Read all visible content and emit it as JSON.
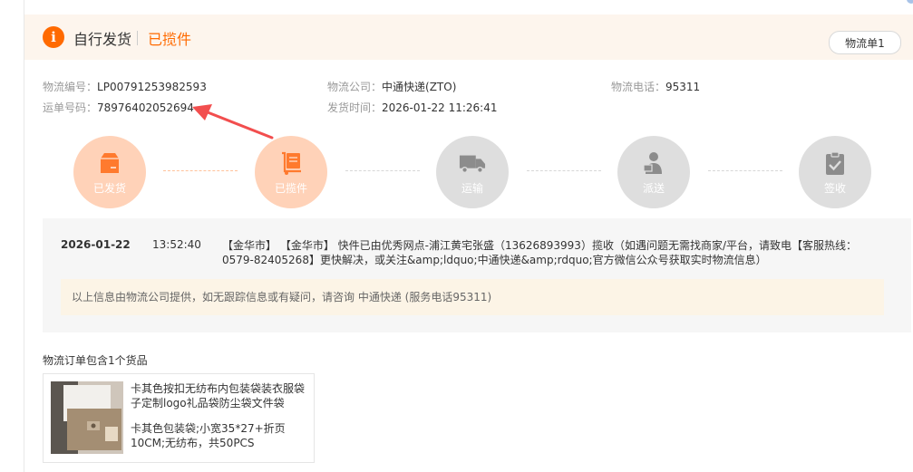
{
  "header": {
    "title": "自行发货",
    "status": "已揽件",
    "tab_label": "物流单1",
    "icon": "info-icon",
    "accent_color": "#ff6a00"
  },
  "meta": {
    "tracking_id_label": "物流编号：",
    "tracking_id": "LP00791253982593",
    "waybill_label": "运单号码：",
    "waybill": "78976402052694",
    "company_label": "物流公司：",
    "company": "中通快递(ZTO)",
    "ship_time_label": "发货时间：",
    "ship_time": "2026-01-22 11:26:41",
    "phone_label": "物流电话：",
    "phone": "95311"
  },
  "steps": [
    {
      "label": "已发货",
      "icon": "package-icon",
      "state": "done"
    },
    {
      "label": "已揽件",
      "icon": "cart-icon",
      "state": "done"
    },
    {
      "label": "运输",
      "icon": "truck-icon",
      "state": "pending"
    },
    {
      "label": "派送",
      "icon": "courier-icon",
      "state": "pending"
    },
    {
      "label": "签收",
      "icon": "clipboard-check-icon",
      "state": "pending"
    }
  ],
  "tracking": {
    "date": "2026-01-22",
    "time": "13:52:40",
    "description": "【金华市】 【金华市】 快件已由优秀网点-浦江黄宅张盛（13626893993）揽收（如遇问题无需找商家/平台，请致电【客服热线：0579-82405268】更快解决，或关注&amp;ldquo;中通快递&amp;rdquo;官方微信公众号获取实时物流信息）",
    "notice": "以上信息由物流公司提供，如无跟踪信息或有疑问，请咨询 中通快递 (服务电话95311)"
  },
  "goods": {
    "title": "物流订单包含1个货品",
    "name": "卡其色按扣无纺布内包装袋装衣服袋子定制logo礼品袋防尘袋文件袋",
    "spec": "卡其色包装袋;小宽35*27+折页10CM;无纺布，共50PCS"
  }
}
